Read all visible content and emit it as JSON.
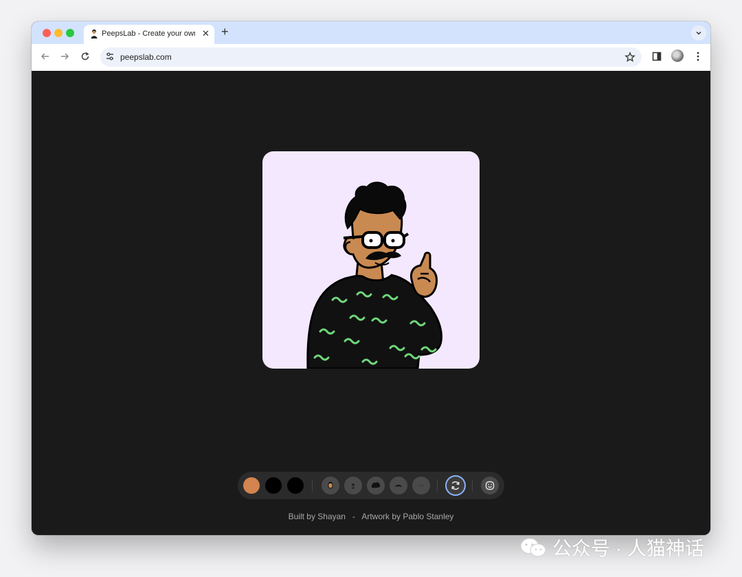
{
  "browser": {
    "tab": {
      "title": "PeepsLab - Create your own p"
    },
    "url": "peepslab.com"
  },
  "avatar_card": {
    "background": "#f3e8fe",
    "skin_color": "#c98a52",
    "sweater_color": "#111111",
    "pattern_color": "#6fd67a"
  },
  "controls": {
    "swatches": [
      {
        "name": "skin",
        "color": "#d3844f"
      },
      {
        "name": "hair",
        "color": "#000000"
      },
      {
        "name": "clothes",
        "color": "#000000"
      }
    ],
    "options": [
      {
        "icon": "head-icon"
      },
      {
        "icon": "face-icon"
      },
      {
        "icon": "hair-icon"
      },
      {
        "icon": "facial-hair-icon"
      },
      {
        "icon": "accessory-icon"
      },
      {
        "icon": "randomize-icon",
        "active": true
      },
      {
        "icon": "download-icon"
      }
    ]
  },
  "footer": {
    "built_by": "Built by Shayan",
    "separator": "-",
    "artwork_by": "Artwork by Pablo Stanley"
  },
  "watermark": {
    "text": "公众号 · 人猫神话"
  }
}
